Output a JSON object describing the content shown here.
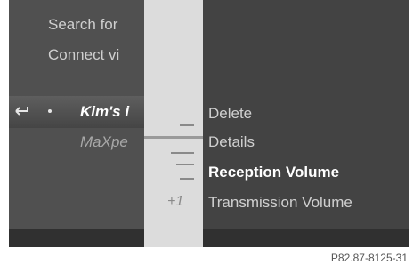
{
  "left_menu": {
    "items": [
      {
        "label": "Search for"
      },
      {
        "label": "Connect vi"
      }
    ],
    "selected_device": "Kim's i",
    "device_secondary": "MaXpe"
  },
  "options_menu": {
    "items": [
      {
        "label": "Delete"
      },
      {
        "label": "Details"
      },
      {
        "label": "Reception Volume"
      },
      {
        "label": "Transmission Volume"
      }
    ],
    "highlighted_index": 2,
    "volume_indicator": "+1"
  },
  "figure_code": "P82.87-8125-31"
}
